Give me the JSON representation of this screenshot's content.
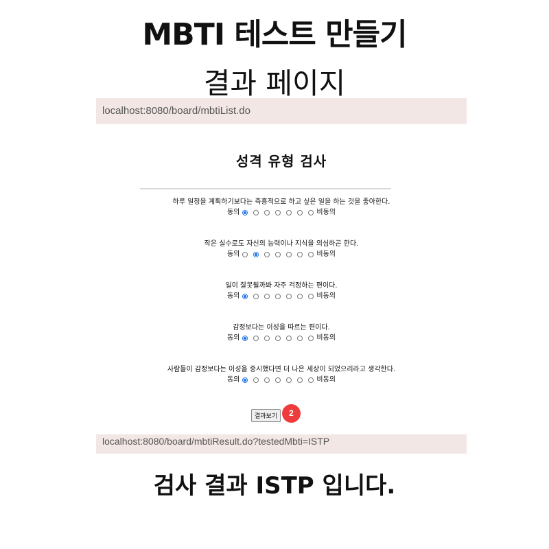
{
  "header": {
    "title": "MBTI 테스트 만들기",
    "subtitle": "결과 페이지"
  },
  "browser": {
    "url_list": "localhost:8080/board/mbtiList.do",
    "url_result": "localhost:8080/board/mbtiResult.do?testedMbti=ISTP"
  },
  "form": {
    "heading": "성격 유형 검사",
    "agree_label": "동의",
    "disagree_label": "비동의",
    "questions": [
      {
        "text": "하루 일정을 계획하기보다는 즉흥적으로 하고 싶은 일을 하는 것을 좋아한다.",
        "selected": 1
      },
      {
        "text": "작은 실수로도 자신의 능력이나 지식을 의심하곤 한다.",
        "selected": 2
      },
      {
        "text": "일이 잘못될까봐 자주 걱정하는 편이다.",
        "selected": 1
      },
      {
        "text": "감정보다는 이성을 따르는 편이다.",
        "selected": 1
      },
      {
        "text": "사람들이 감정보다는 이성을 중시했다면 더 나은 세상이 되었으리라고 생각한다.",
        "selected": 1
      }
    ],
    "submit_label": "결과보기",
    "step_badge": "2"
  },
  "result": {
    "text": "검사 결과 ISTP 입니다."
  }
}
